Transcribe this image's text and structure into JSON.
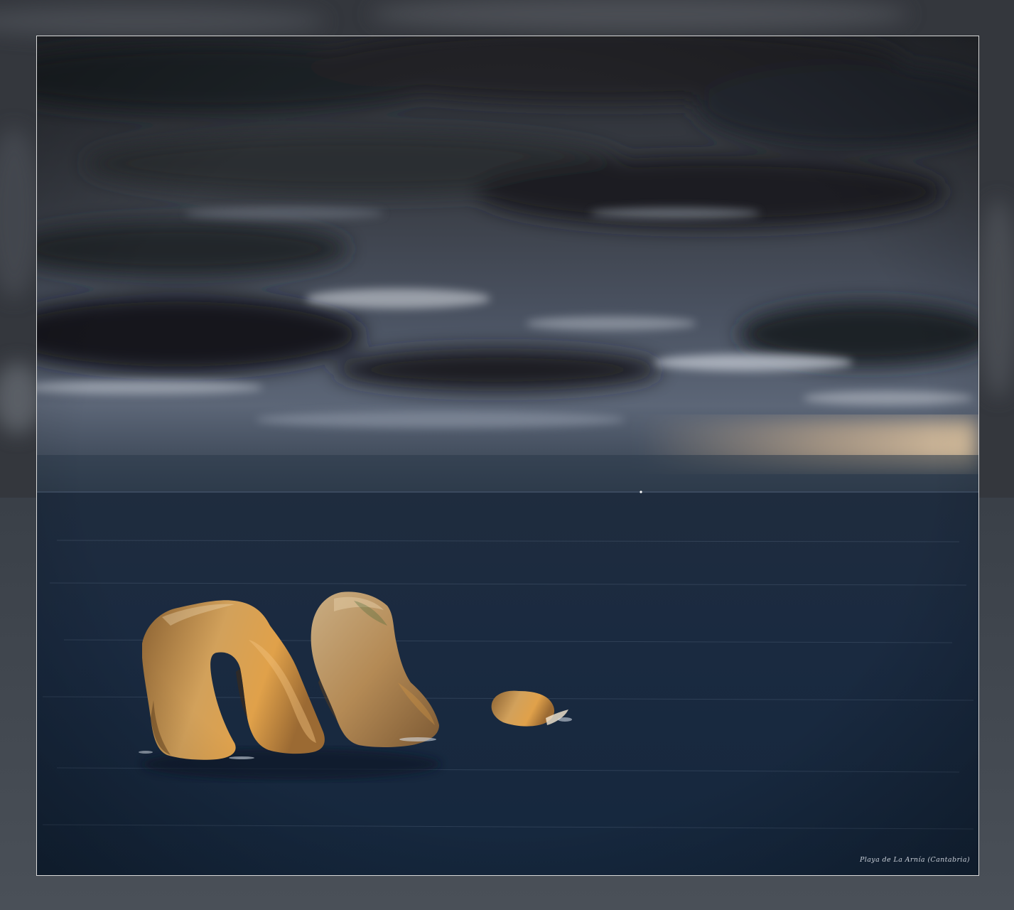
{
  "photo": {
    "caption": "Playa de La Arnía (Cantabria)"
  },
  "palette": {
    "storm_cloud": "#1c1f25",
    "sky_light": "#9aa3b3",
    "sunset_glow": "#e8c49a",
    "sea_deep": "#17263b",
    "rock_lit": "#d99a45",
    "rock_shadow": "#7a5026",
    "frame_line": "#d9d9d9"
  }
}
